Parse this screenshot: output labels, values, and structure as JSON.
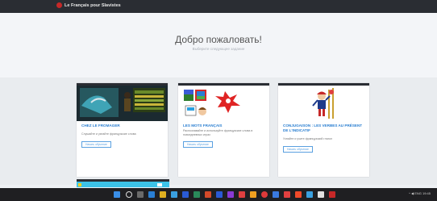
{
  "header": {
    "brand": "Le Français pour Slavistes"
  },
  "hero": {
    "title": "Добро пожаловать!",
    "subtitle": "Выберите следующее задание"
  },
  "cards": [
    {
      "title": "CHEZ LE FROMAGER",
      "description": "Слушайте и узнайте французские слова",
      "button": "Начать обучение"
    },
    {
      "title": "LES MOTS FRANÇAIS",
      "description": "Распознавайте и используйте французские слова в повседневных играх",
      "button": "Начать обучение"
    },
    {
      "title": "CONJUGAISON : LES VERBES AU PRÉSENT DE L'INDICATIF",
      "description": "Узнайте и учите французский глагол",
      "button": "Начать обучение"
    }
  ],
  "taskbar": {
    "tray": "^ ◀ ENG 19:45"
  },
  "colors": {
    "accent": "#2b7fd1",
    "header_bg": "#2a2d33",
    "taskbar_bg": "#1f1f22"
  }
}
